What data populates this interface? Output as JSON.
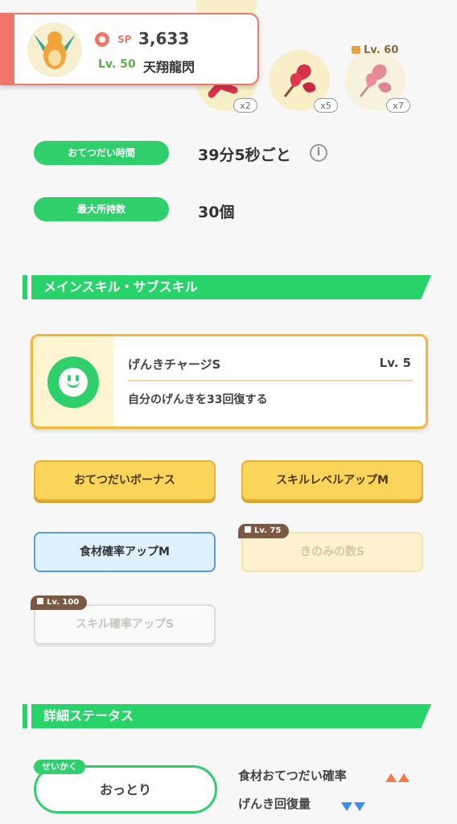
{
  "pokemon": {
    "sp_label": "SP",
    "sp_value": "3,633",
    "level": "Lv. 50",
    "name": "天翔龍閃"
  },
  "berries": {
    "counts": [
      "x2",
      "x5",
      "x7"
    ],
    "locked_level": "Lv. 60"
  },
  "stats": {
    "help_time_label": "おてつだい時間",
    "help_time_value": "39分5秒ごと",
    "max_items_label": "最大所持数",
    "max_items_value": "30個"
  },
  "skills_section": {
    "title": "メインスキル・サブスキル",
    "main_skill": {
      "name": "げんきチャージS",
      "level": "Lv. 5",
      "description": "自分のげんきを33回復する"
    },
    "sub_skills": [
      {
        "label": "おてつだいボーナス"
      },
      {
        "label": "スキルレベルアップM"
      },
      {
        "label": "食材確率アップM"
      },
      {
        "label": "きのみの数S",
        "unlock": "Lv. 75"
      },
      {
        "label": "スキル確率アップS",
        "unlock": "Lv. 100"
      }
    ]
  },
  "detail_section": {
    "title": "詳細ステータス",
    "nature_tag": "せいかく",
    "nature": "おっとり",
    "effects": [
      {
        "label": "食材おてつだい確率",
        "direction": "up"
      },
      {
        "label": "げんき回復量",
        "direction": "down"
      }
    ]
  },
  "colors": {
    "accent_green": "#28d36a",
    "accent_red": "#f0766a",
    "gold": "#fbd45a"
  }
}
